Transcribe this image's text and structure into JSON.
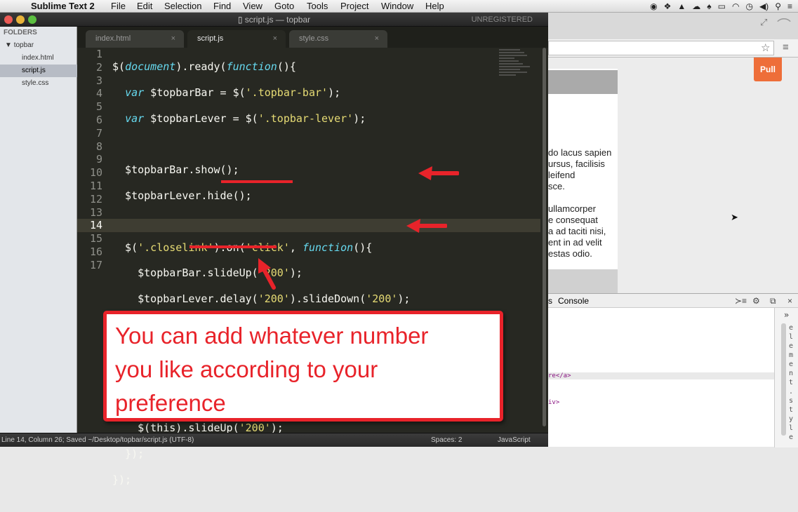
{
  "menubar": {
    "apple": "",
    "app_name": "Sublime Text 2",
    "items": [
      "File",
      "Edit",
      "Selection",
      "Find",
      "View",
      "Goto",
      "Tools",
      "Project",
      "Window",
      "Help"
    ]
  },
  "window": {
    "title": "script.js — topbar",
    "registration": "UNREGISTERED"
  },
  "sidebar": {
    "header": "FOLDERS",
    "folder": "topbar",
    "files": [
      "index.html",
      "script.js",
      "style.css"
    ]
  },
  "tabs": [
    {
      "label": "index.html",
      "close": "×"
    },
    {
      "label": "script.js",
      "close": "×"
    },
    {
      "label": "style.css",
      "close": "×"
    }
  ],
  "editor": {
    "line_numbers": [
      "1",
      "2",
      "3",
      "4",
      "5",
      "6",
      "7",
      "8",
      "9",
      "10",
      "11",
      "12",
      "13",
      "14",
      "15",
      "16",
      "17"
    ],
    "current_line": "14"
  },
  "statusbar": {
    "position": "Line 14, Column 26; Saved ~/Desktop/topbar/script.js (UTF-8)",
    "spaces": "Spaces: 2",
    "syntax": "JavaScript"
  },
  "browser": {
    "pull_button": "Pull",
    "lorem": [
      "do lacus sapien",
      "ursus, facilisis",
      "leifend",
      "sce.",
      "",
      "ullamcorper",
      "e consequat",
      "a ad taciti nisi,",
      "ent in ad velit",
      "estas odio."
    ],
    "devtools_tab": "Console",
    "dom_fragment_1": "re</a>",
    "dom_fragment_2": "iv>",
    "side_text": "element.style"
  },
  "annotation": {
    "callout_text": [
      "You can add whatever number",
      "you like according to your",
      "preference"
    ],
    "accent": "#e8232a"
  },
  "colors": {
    "editor_bg": "#272822",
    "keyword": "#66d9ef",
    "string": "#e6db74",
    "function": "#a6e22e"
  }
}
